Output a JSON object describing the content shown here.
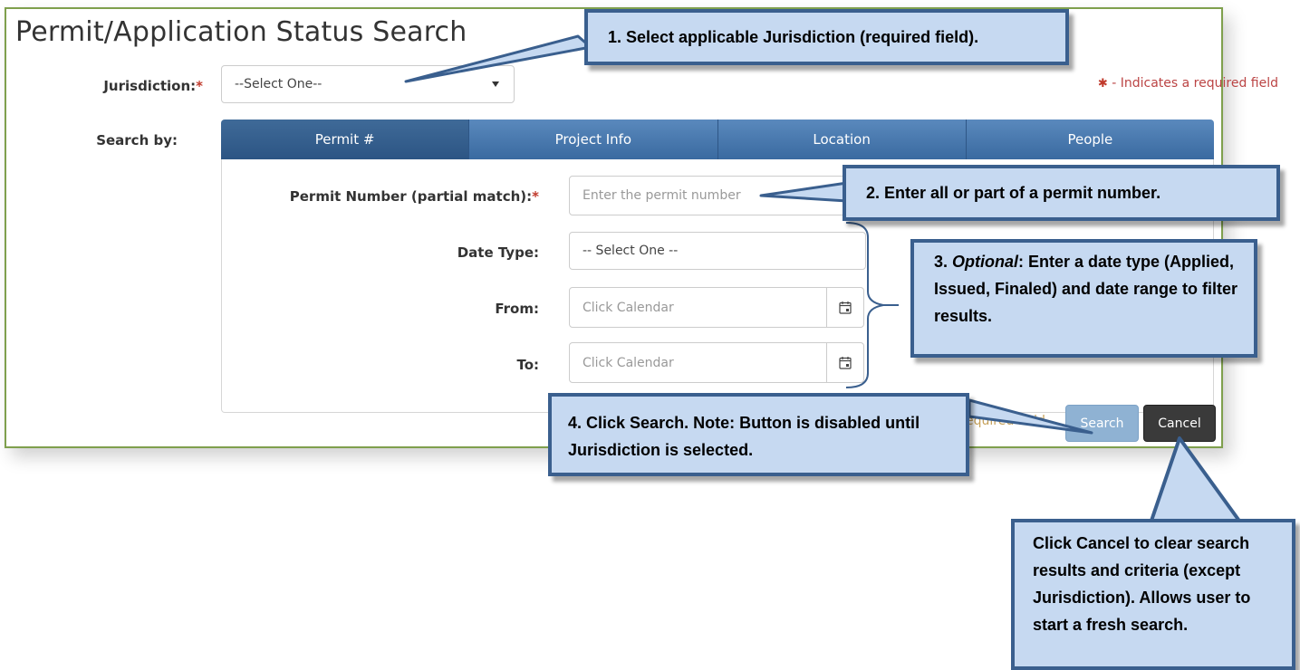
{
  "page": {
    "title": "Permit/Application Status Search"
  },
  "jurisdiction": {
    "label": "Jurisdiction:",
    "required_mark": "*",
    "selected": "--Select One--"
  },
  "required_note": {
    "mark": "✱",
    "text": " - Indicates a required field"
  },
  "search_by": {
    "label": "Search by:",
    "tabs": [
      {
        "label": "Permit #",
        "active": true
      },
      {
        "label": "Project Info",
        "active": false
      },
      {
        "label": "Location",
        "active": false
      },
      {
        "label": "People",
        "active": false
      }
    ]
  },
  "form": {
    "permit_number": {
      "label": "Permit Number (partial match):",
      "required_mark": "*",
      "placeholder": "Enter the permit number"
    },
    "date_type": {
      "label": "Date Type:",
      "selected": "-- Select One --"
    },
    "from": {
      "label": "From:",
      "placeholder": "Click Calendar"
    },
    "to": {
      "label": "To:",
      "placeholder": "Click Calendar"
    }
  },
  "footer": {
    "required_text": "equired field",
    "search_label": "Search",
    "cancel_label": "Cancel"
  },
  "callouts": {
    "c1": "1. Select applicable Jurisdiction (required field).",
    "c2": "2. Enter all or part of a permit number.",
    "c3_prefix": "3. ",
    "c3_em": "Optional",
    "c3_text": ": Enter a date type (Applied, Issued, Finaled) and date range to filter results.",
    "c4": "4. Click Search. Note: Button is disabled until Jurisdiction is selected.",
    "c5": "Click Cancel to clear search results and criteria (except Jurisdiction). Allows user to start a fresh search."
  },
  "colors": {
    "accent": "#3a6aa0",
    "border": "#7fa04d",
    "callout_bg": "#c6d9f1",
    "callout_border": "#3a5f8e"
  },
  "icons": {
    "calendar": "calendar-icon",
    "caret": "chevron-down-icon"
  }
}
